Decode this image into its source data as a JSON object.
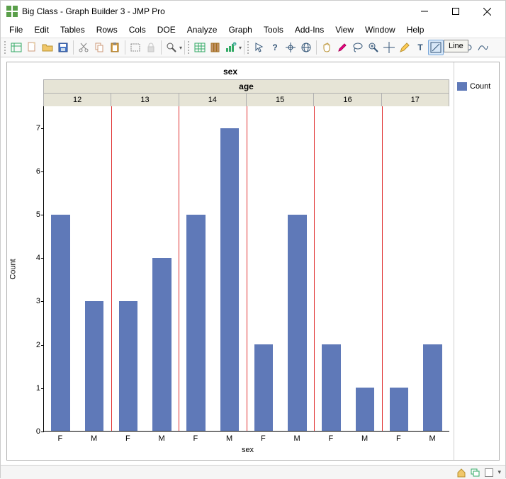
{
  "window": {
    "title": "Big Class - Graph Builder 3 - JMP Pro"
  },
  "menu": {
    "items": [
      "File",
      "Edit",
      "Tables",
      "Rows",
      "Cols",
      "DOE",
      "Analyze",
      "Graph",
      "Tools",
      "Add-Ins",
      "View",
      "Window",
      "Help"
    ]
  },
  "tooltip": {
    "text": "Line"
  },
  "legend": {
    "label": "Count"
  },
  "chart_top_label": "sex",
  "chart_group_label": "age",
  "x_axis_title": "sex",
  "y_axis_title": "Count",
  "y_ticks": [
    "0",
    "1",
    "2",
    "3",
    "4",
    "5",
    "6",
    "7"
  ],
  "chart_data": {
    "type": "bar",
    "title": "",
    "xlabel": "sex",
    "ylabel": "Count",
    "ylim": [
      0,
      7.5
    ],
    "facets": [
      "12",
      "13",
      "14",
      "15",
      "16",
      "17"
    ],
    "categories": [
      "F",
      "M"
    ],
    "series": [
      {
        "facet": "12",
        "values": [
          5,
          3
        ]
      },
      {
        "facet": "13",
        "values": [
          3,
          4
        ]
      },
      {
        "facet": "14",
        "values": [
          5,
          7
        ]
      },
      {
        "facet": "15",
        "values": [
          2,
          5
        ]
      },
      {
        "facet": "16",
        "values": [
          2,
          1
        ]
      },
      {
        "facet": "17",
        "values": [
          1,
          2
        ]
      }
    ]
  }
}
